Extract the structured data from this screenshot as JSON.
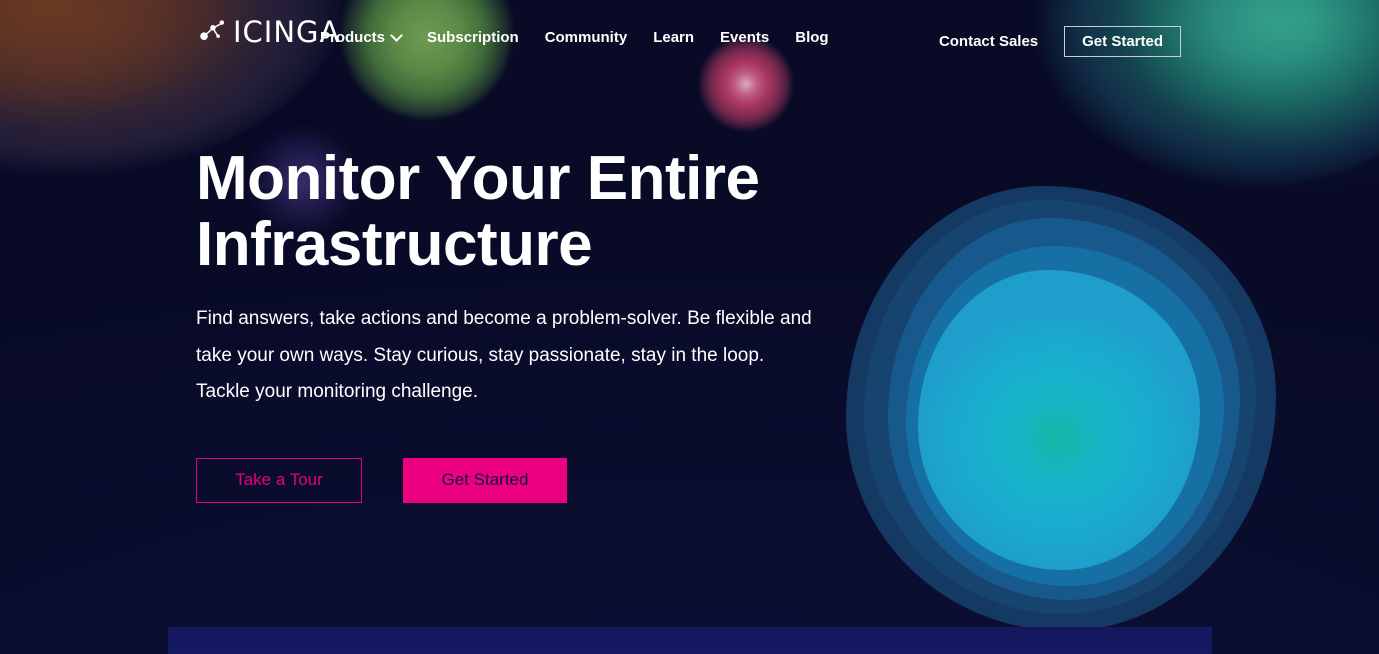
{
  "site": {
    "brand_name": "ICINGA",
    "brand_icon": "molecule-nodes-icon"
  },
  "header": {
    "nav_items": [
      {
        "label": "Products",
        "has_dropdown": true,
        "icon": "chevron-down-icon"
      },
      {
        "label": "Subscription",
        "has_dropdown": false
      },
      {
        "label": "Community",
        "has_dropdown": false
      },
      {
        "label": "Learn",
        "has_dropdown": false
      },
      {
        "label": "Events",
        "has_dropdown": false
      },
      {
        "label": "Blog",
        "has_dropdown": false
      }
    ],
    "contact_sales_label": "Contact Sales",
    "get_started_label": "Get Started"
  },
  "hero": {
    "title": "Monitor Your Entire Infrastructure",
    "subtitle": "Find answers, take actions and become a problem-solver. Be flexible and take your own ways. Stay curious, stay passionate, stay in the loop. Tackle your monitoring challenge.",
    "primary_cta": "Get Started",
    "secondary_cta": "Take a Tour"
  },
  "colors": {
    "accent_magenta": "#ea0080",
    "accent_magenta_outline": "#e6007e",
    "background_navy": "#0a0d2e",
    "blob_cyan_core": "#18b1cd",
    "blob_teal_center": "#12b7a4",
    "blob_mid_blue": "#1670a4",
    "blob_outer_blue": "#143a63",
    "orb_green": "#5b8a46",
    "orb_pink": "#a8355f",
    "corner_warm": "#6d3b22",
    "corner_green": "#31a68e",
    "bottom_panel": "#15185e",
    "text_white": "#ffffff",
    "header_button_border": "#c9cbd8"
  }
}
